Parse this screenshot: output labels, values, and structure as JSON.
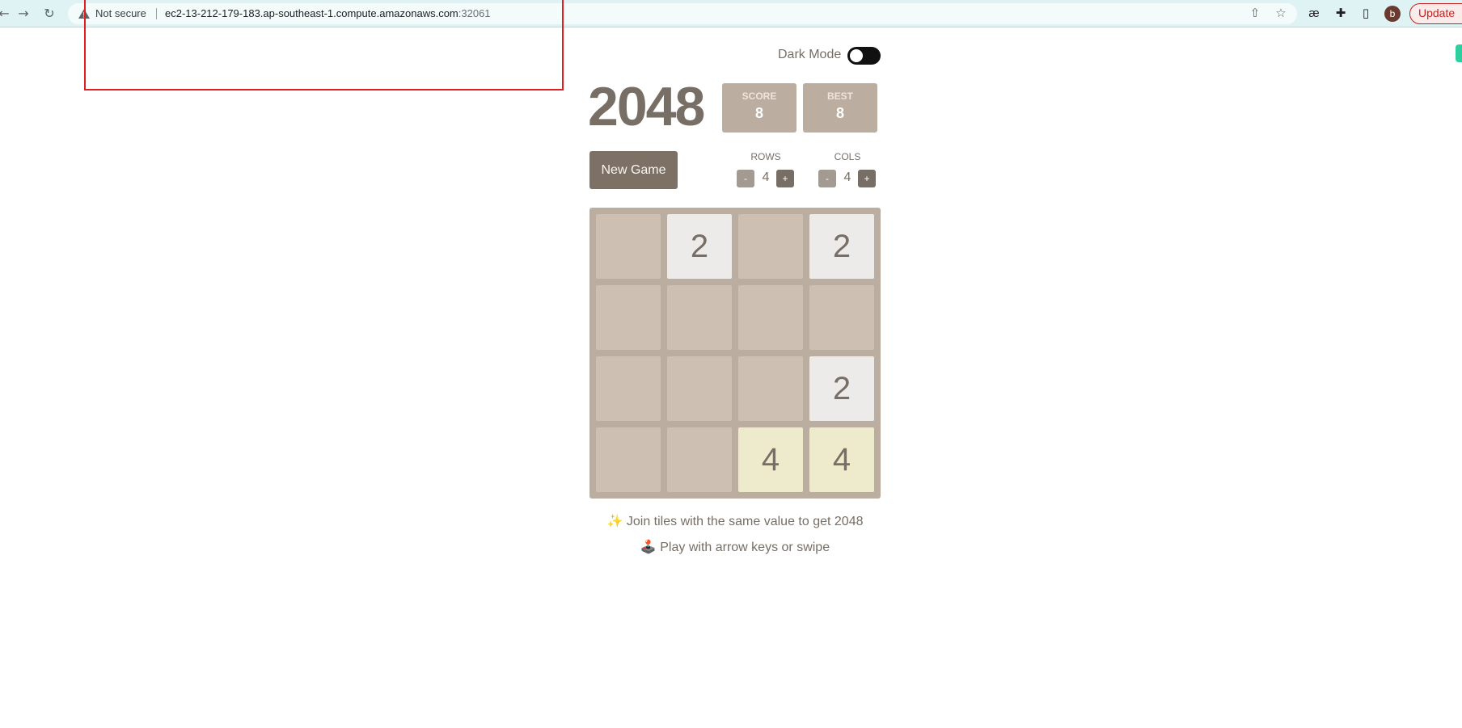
{
  "browser": {
    "not_secure": "Not secure",
    "url_host": "ec2-13-212-179-183.ap-southeast-1.compute.amazonaws.com",
    "url_port": ":32061",
    "profile_initial": "b",
    "update_label": "Update"
  },
  "game": {
    "dark_mode_label": "Dark Mode",
    "dark_mode_on": false,
    "title": "2048",
    "score_label": "SCORE",
    "score": "8",
    "best_label": "BEST",
    "best": "8",
    "new_game_label": "New Game",
    "rows_label": "ROWS",
    "rows": "4",
    "cols_label": "COLS",
    "cols": "4",
    "minus": "-",
    "plus": "+",
    "board": [
      [
        "",
        "2",
        "",
        "2"
      ],
      [
        "",
        "",
        "",
        ""
      ],
      [
        "",
        "",
        "",
        "2"
      ],
      [
        "",
        "",
        "4",
        "4"
      ]
    ],
    "hint1": "✨ Join tiles with the same value to get 2048",
    "hint2": "🕹️ Play with arrow keys or swipe"
  },
  "colors": {
    "board": "#bbada0",
    "empty_cell": "#cdbfb2",
    "tile_2": "#ecebea",
    "tile_4": "#eeebcc",
    "text": "#776e65"
  }
}
